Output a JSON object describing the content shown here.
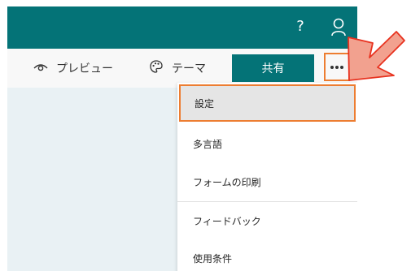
{
  "header": {
    "help_icon": "?",
    "account_icon": "person-icon"
  },
  "toolbar": {
    "preview_label": "プレビュー",
    "preview_icon": "eye-icon",
    "theme_label": "テーマ",
    "theme_icon": "palette-icon",
    "share_label": "共有",
    "more_label": "•••"
  },
  "menu": {
    "items": [
      {
        "label": "設定",
        "highlighted": true
      },
      {
        "label": "多言語"
      },
      {
        "label": "フォームの印刷"
      },
      {
        "label": "フィードバック"
      },
      {
        "label": "使用条件"
      }
    ]
  },
  "colors": {
    "brand_teal": "#047377",
    "highlight_orange": "#ed7d31",
    "canvas_bg": "#e9f1f4",
    "pointer_arrow": "#f2a18f"
  }
}
